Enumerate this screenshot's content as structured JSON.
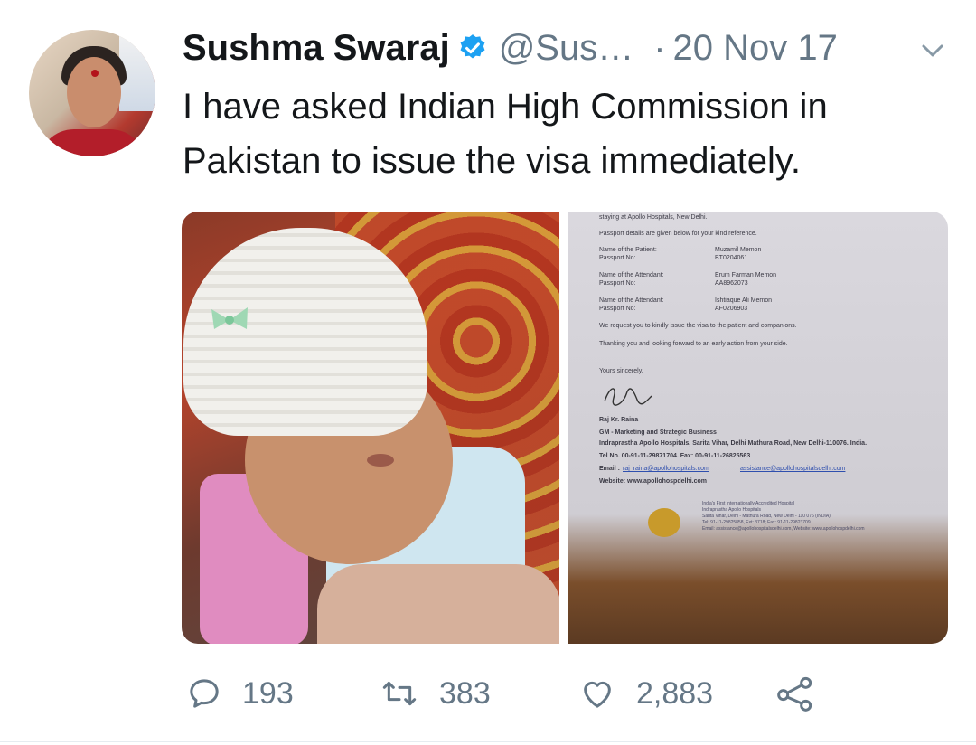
{
  "tweet": {
    "author_name": "Sushma Swaraj",
    "handle": "@Sus…",
    "separator": "·",
    "date": "20 Nov 17",
    "text": "I have asked Indian High Commission in Pakistan to issue the visa immediately.",
    "verified": true,
    "accent_color": "#1da1f2"
  },
  "media": {
    "left_image": "baby-photo",
    "right_image": "letter-document",
    "letter": {
      "line_top": "staying at Apollo Hospitals, New Delhi.",
      "intro": "Passport details are given below for your kind reference.",
      "patient_label": "Name of the Patient:",
      "patient_value": "Muzamil Memon",
      "passport_label": "Passport No:",
      "passport_value_1": "BT0204061",
      "attendant_label": "Name of the Attendant:",
      "attendant_value_1": "Erum Farman Memon",
      "passport_value_2": "AA8962073",
      "attendant_value_2": "Ishtiaque Ali Memon",
      "passport_value_3": "AF0206903",
      "request": "We request you to kindly issue the visa to the patient and companions.",
      "thanks": "Thanking you and looking forward to an early action from your side.",
      "closing": "Yours sincerely,",
      "signer": "Raj Kr. Raina",
      "title": "GM - Marketing and Strategic Business",
      "address": "Indraprastha Apollo Hospitals, Sarita Vihar, Delhi Mathura Road, New Delhi-110076. India.",
      "tel": "Tel No. 00-91-11-29871704. Fax: 00-91-11-26825563",
      "email_label": "Email :",
      "email_1": "raj_raina@apollohospitals.com",
      "email_2": "assistance@apollohospitalsdelhi.com",
      "website": "Website: www.apollohospdelhi.com",
      "footer_1": "India's First Internationally Accredited Hospital",
      "footer_2": "Indraprastha Apollo Hospitals",
      "footer_3": "Sarita Vihar, Delhi - Mathura Road, New Delhi - 110 076 (INDIA)",
      "footer_4": "Tel: 91-11-29825858, Ext: 3718; Fax: 91-11-29823709",
      "footer_5": "Email: assistance@apollohospitalsdelhi.com, Website: www.apollohospdelhi.com"
    }
  },
  "actions": {
    "reply_count": "193",
    "retweet_count": "383",
    "like_count": "2,883",
    "icons": [
      "reply-icon",
      "retweet-icon",
      "like-icon",
      "share-icon"
    ]
  }
}
